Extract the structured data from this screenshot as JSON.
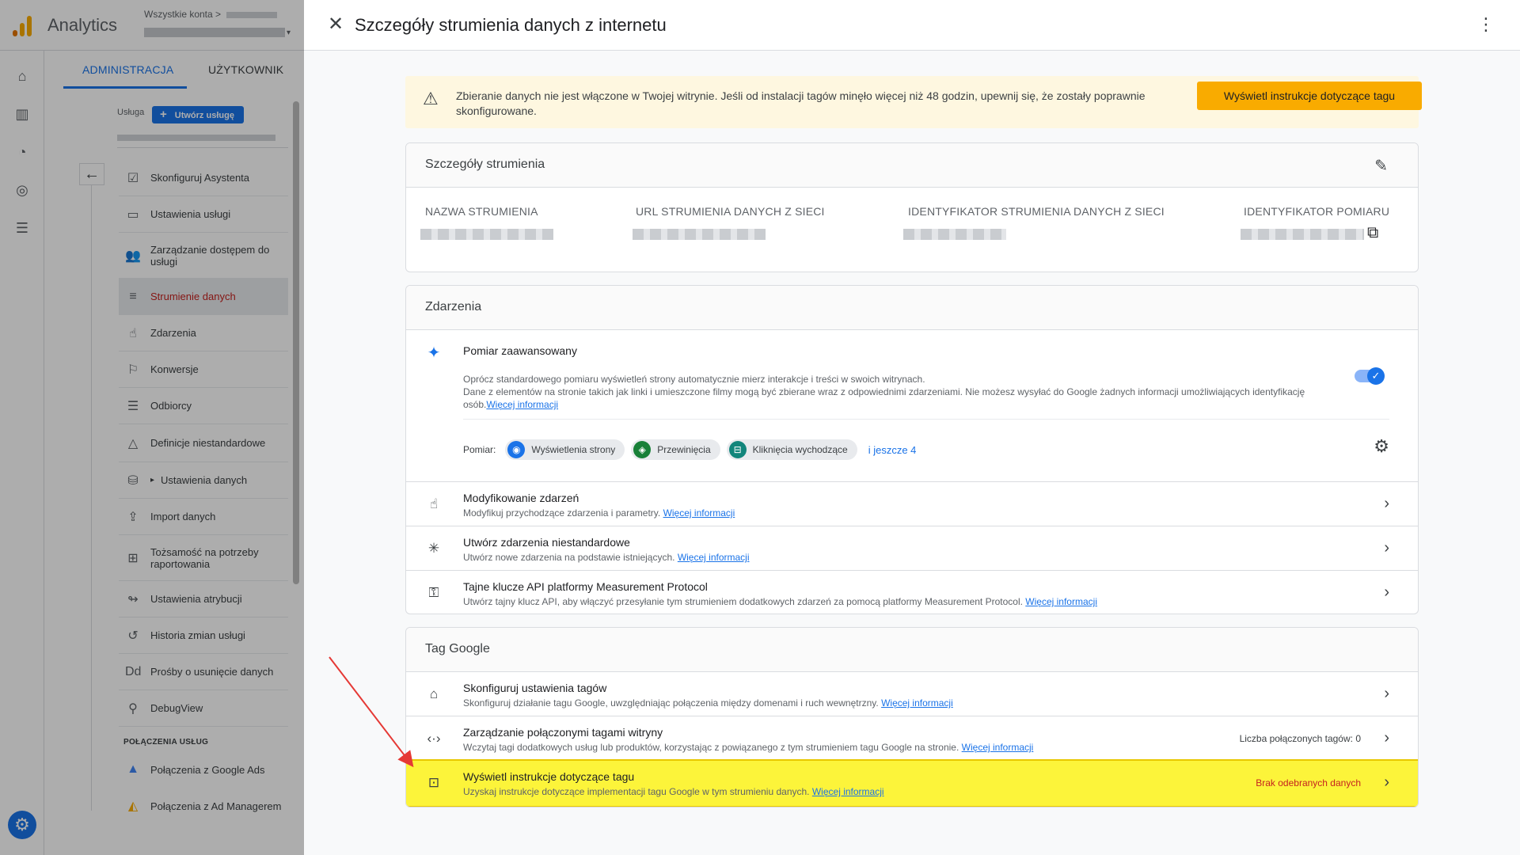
{
  "app": {
    "name": "Analytics",
    "account_crumb": "Wszystkie konta",
    "crumb_sep": ">",
    "caret": "▾"
  },
  "admin": {
    "tabs": [
      {
        "label": "ADMINISTRACJA"
      },
      {
        "label": "UŻYTKOWNIK"
      }
    ],
    "service_label": "Usługa",
    "create_service_button": "Utwórz usługę",
    "back_arrow": "←",
    "nav": [
      {
        "label": "Skonfiguruj Asystenta",
        "icon": "☑"
      },
      {
        "label": "Ustawienia usługi",
        "icon": "▭"
      },
      {
        "label": "Zarządzanie dostępem do usługi",
        "icon": "👥"
      },
      {
        "label": "Strumienie danych",
        "icon": "≡"
      },
      {
        "label": "Zdarzenia",
        "icon": "☝"
      },
      {
        "label": "Konwersje",
        "icon": "⚐"
      },
      {
        "label": "Odbiorcy",
        "icon": "☰"
      },
      {
        "label": "Definicje niestandardowe",
        "icon": "△"
      },
      {
        "label": "Ustawienia danych",
        "icon": "⛁",
        "expander": "▸"
      },
      {
        "label": "Import danych",
        "icon": "⇪"
      },
      {
        "label": "Tożsamość na potrzeby raportowania",
        "icon": "⊞"
      },
      {
        "label": "Ustawienia atrybucji",
        "icon": "↬"
      },
      {
        "label": "Historia zmian usługi",
        "icon": "↺"
      },
      {
        "label": "Prośby o usunięcie danych",
        "icon": "Dd"
      },
      {
        "label": "DebugView",
        "icon": "⚲"
      }
    ],
    "section_title": "POŁĄCZENIA USŁUG",
    "links": [
      {
        "label": "Połączenia z Google Ads",
        "icon": "▲"
      },
      {
        "label": "Połączenia z Ad Managerem",
        "icon": "◭"
      }
    ]
  },
  "rail_icons": [
    "home-icon",
    "reports-icon",
    "explore-icon",
    "advertising-icon",
    "configure-icon"
  ],
  "rail_glyphs": [
    "⌂",
    "▥",
    "◔",
    "◎",
    "☰"
  ],
  "panel": {
    "title": "Szczegóły strumienia danych z internetu",
    "close_glyph": "✕",
    "menu_glyph": "⋮",
    "warning": {
      "icon": "⚠",
      "text": "Zbieranie danych nie jest włączone w Twojej witrynie. Jeśli od instalacji tagów minęło więcej niż 48 godzin, upewnij się, że zostały poprawnie skonfigurowane.",
      "button": "Wyświetl instrukcje dotyczące tagu"
    },
    "stream_details": {
      "title": "Szczegóły strumienia",
      "edit_glyph": "✎",
      "copy_glyph": "⧉",
      "fields": [
        {
          "label": "NAZWA STRUMIENIA"
        },
        {
          "label": "URL STRUMIENIA DANYCH Z SIECI"
        },
        {
          "label": "IDENTYFIKATOR STRUMIENIA DANYCH Z SIECI"
        },
        {
          "label": "IDENTYFIKATOR POMIARU"
        }
      ]
    },
    "events": {
      "title": "Zdarzenia",
      "enhanced": {
        "icon": "✦",
        "title": "Pomiar zaawansowany",
        "desc1": "Oprócz standardowego pomiaru wyświetleń strony automatycznie mierz interakcje i treści w swoich witrynach.",
        "desc2": "Dane z elementów na stronie takich jak linki i umieszczone filmy mogą być zbierane wraz z odpowiednimi zdarzeniami. Nie możesz wysyłać do Google żadnych informacji umożliwiających identyfikację osób.",
        "link": "Więcej informacji",
        "toggle_on": true,
        "toggle_glyph": "✓",
        "measure_label": "Pomiar:",
        "chips": [
          {
            "label": "Wyświetlenia strony",
            "icon": "◉",
            "color": "#1a73e8"
          },
          {
            "label": "Przewinięcia",
            "icon": "◈",
            "color": "#188038"
          },
          {
            "label": "Kliknięcia wychodzące",
            "icon": "⊟",
            "color": "#12857b"
          }
        ],
        "more": "i jeszcze 4",
        "settings_glyph": "⚙"
      },
      "rows": [
        {
          "icon": "☝",
          "title": "Modyfikowanie zdarzeń",
          "desc": "Modyfikuj przychodzące zdarzenia i parametry.",
          "link": "Więcej informacji"
        },
        {
          "icon": "✳",
          "title": "Utwórz zdarzenia niestandardowe",
          "desc": "Utwórz nowe zdarzenia na podstawie istniejących.",
          "link": "Więcej informacji"
        },
        {
          "icon": "⚿",
          "title": "Tajne klucze API platformy Measurement Protocol",
          "desc": "Utwórz tajny klucz API, aby włączyć przesyłanie tym strumieniem dodatkowych zdarzeń za pomocą platformy Measurement Protocol.",
          "link": "Więcej informacji"
        }
      ]
    },
    "google_tag": {
      "title": "Tag Google",
      "rows": [
        {
          "icon": "⌂",
          "title": "Skonfiguruj ustawienia tagów",
          "desc": "Skonfiguruj działanie tagu Google, uwzględniając połączenia między domenami i ruch wewnętrzny.",
          "link": "Więcej informacji",
          "note": ""
        },
        {
          "icon": "‹·›",
          "title": "Zarządzanie połączonymi tagami witryny",
          "desc": "Wczytaj tagi dodatkowych usług lub produktów, korzystając z powiązanego z tym strumieniem tagu Google na stronie.",
          "link": "Więcej informacji",
          "note": "Liczba połączonych tagów: 0"
        },
        {
          "icon": "⊡",
          "title": "Wyświetl instrukcje dotyczące tagu",
          "desc": "Uzyskaj instrukcje dotyczące implementacji tagu Google w tym strumieniu danych.",
          "link": "Więcej informacji",
          "note": "Brak odebranych danych",
          "highlighted": true
        }
      ]
    },
    "chevron": "›"
  },
  "colors": {
    "accent": "#1a73e8",
    "warning_bg": "#fef7e0",
    "warning_btn": "#f9ab00",
    "highlight": "#fcf43a",
    "annotation": "#e53935"
  }
}
